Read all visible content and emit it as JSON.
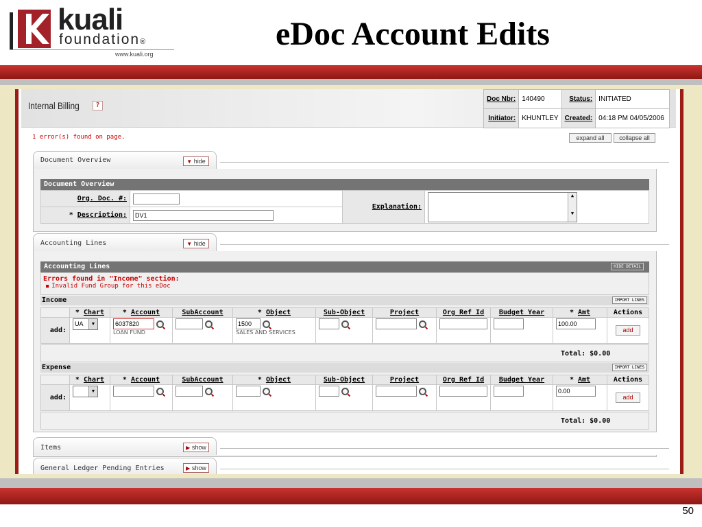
{
  "slide": {
    "title": "eDoc Account Edits",
    "page_number": "50",
    "logo": {
      "brand": "kuali",
      "sub": "foundation",
      "reg": "®",
      "url": "www.kuali.org"
    }
  },
  "doc": {
    "title": "Internal Billing",
    "help": "?",
    "header": {
      "doc_nbr_label": "Doc Nbr:",
      "doc_nbr": "140490",
      "status_label": "Status:",
      "status": "INITIATED",
      "initiator_label": "Initiator:",
      "initiator": "KHUNTLEY",
      "created_label": "Created:",
      "created": "04:18 PM 04/05/2006"
    },
    "error_message": "1 error(s) found on page.",
    "expand_all": "expand all",
    "collapse_all": "collapse all"
  },
  "overview": {
    "tab_label": "Document Overview",
    "tab_button": "hide",
    "section_title": "Document Overview",
    "org_doc_label": "Org. Doc. #:",
    "org_doc_value": "",
    "description_prefix": "* ",
    "description_label": "Description:",
    "description_value": "DV1",
    "explanation_label": "Explanation:",
    "explanation_value": ""
  },
  "accounting": {
    "tab_label": "Accounting Lines",
    "tab_button": "hide",
    "section_title": "Accounting Lines",
    "hide_detail": "HIDE DETAIL",
    "error_title": "Errors found in \"Income\" section:",
    "error_item": "Invalid Fund Group for this eDoc",
    "error_bullet": "■",
    "import_lines": "IMPORT LINES",
    "columns": {
      "chart": "Chart",
      "account": "Account",
      "subaccount": "SubAccount",
      "object": "Object",
      "subobject": "Sub-Object",
      "project": "Project",
      "orgref": "Org Ref Id",
      "budget": "Budget Year",
      "amt": "Amt",
      "actions": "Actions",
      "req": "* "
    },
    "income": {
      "title": "Income",
      "add_label": "add:",
      "chart": "UA",
      "account": "6037820",
      "account_desc": "LOAN FUND",
      "subaccount": "",
      "object": "1500",
      "object_desc": "SALES AND SERVICES",
      "subobject": "",
      "project": "",
      "orgref": "",
      "budget": "",
      "amt": "100.00",
      "add_button": "add",
      "total": "Total: $0.00"
    },
    "expense": {
      "title": "Expense",
      "add_label": "add:",
      "chart": "",
      "account": "",
      "subaccount": "",
      "object": "",
      "subobject": "",
      "project": "",
      "orgref": "",
      "budget": "",
      "amt": "0.00",
      "add_button": "add",
      "total": "Total: $0.00"
    }
  },
  "items_tab": {
    "label": "Items",
    "button": "show"
  },
  "gl_tab": {
    "label": "General Ledger Pending Entries",
    "button": "show"
  }
}
